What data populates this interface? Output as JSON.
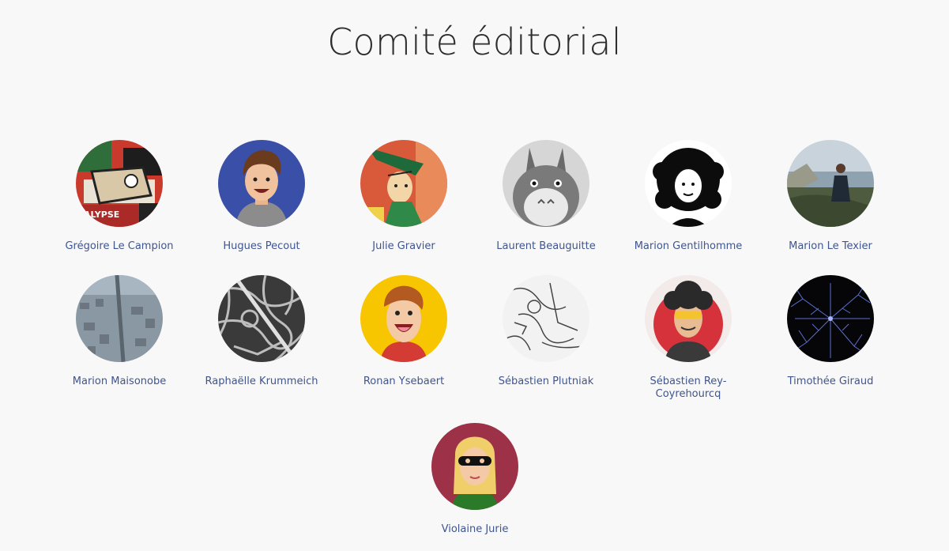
{
  "page": {
    "title": "Comité éditorial"
  },
  "members": [
    {
      "name": "Grégoire Le Campion",
      "icon": "grafitti-avatar-icon"
    },
    {
      "name": "Hugues Pecout",
      "icon": "cartoon-man-avatar-icon"
    },
    {
      "name": "Julie Gravier",
      "icon": "comic-avatar-icon"
    },
    {
      "name": "Laurent Beauguitte",
      "icon": "totoro-avatar-icon"
    },
    {
      "name": "Marion Gentilhomme",
      "icon": "curly-hair-avatar-icon"
    },
    {
      "name": "Marion Le Texier",
      "icon": "cliff-photo-avatar-icon"
    },
    {
      "name": "Marion Maisonobe",
      "icon": "aerial-city-avatar-icon"
    },
    {
      "name": "Raphaëlle Krummeich",
      "icon": "map-pattern-avatar-icon"
    },
    {
      "name": "Ronan Ysebaert",
      "icon": "laughing-boy-avatar-icon"
    },
    {
      "name": "Sébastien Plutniak",
      "icon": "sketch-avatar-icon"
    },
    {
      "name": "Sébastien Rey-Coyrehourcq",
      "icon": "sunglasses-avatar-icon"
    },
    {
      "name": "Timothée Giraud",
      "icon": "network-avatar-icon"
    },
    {
      "name": "Violaine Jurie",
      "icon": "masked-woman-avatar-icon"
    }
  ]
}
